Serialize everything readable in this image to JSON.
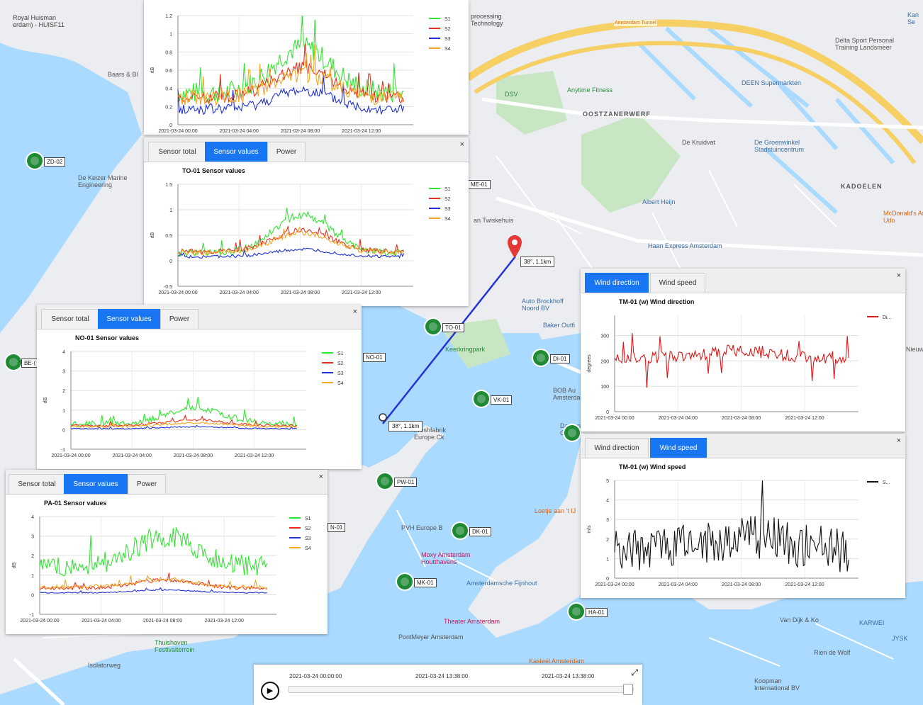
{
  "colors": {
    "s1": "#2ee82e",
    "s2": "#e8301e",
    "s3": "#2030d8",
    "s4": "#f5a623",
    "wind_dir": "#dd1515",
    "wind_speed": "#111111",
    "tab_active": "#1976f2"
  },
  "tabs_sensor": {
    "total": "Sensor total",
    "values": "Sensor values",
    "power": "Power"
  },
  "tabs_wind": {
    "direction": "Wind direction",
    "speed": "Wind speed"
  },
  "close_glyph": "×",
  "legend_sensor": [
    "S1",
    "S2",
    "S3",
    "S4"
  ],
  "chart_data": [
    {
      "id": "chart-top",
      "type": "line",
      "title": "",
      "ylabel": "dB",
      "ylim": [
        0,
        1.2
      ],
      "yticks": [
        "0",
        "0.2",
        "0.4",
        "0.6",
        "0.8",
        "1",
        "1.2"
      ],
      "xticks": [
        "2021-03-24 00:00",
        "2021-03-24 04:00",
        "2021-03-24 08:00",
        "2021-03-24 12:00"
      ],
      "series": [
        {
          "name": "S1",
          "base": 0.35,
          "peak": 0.85,
          "noise": 0.12
        },
        {
          "name": "S2",
          "base": 0.3,
          "peak": 0.62,
          "noise": 0.07
        },
        {
          "name": "S3",
          "base": 0.17,
          "peak": 0.38,
          "noise": 0.06
        },
        {
          "name": "S4",
          "base": 0.3,
          "peak": 0.55,
          "noise": 0.09
        }
      ]
    },
    {
      "id": "chart-to01",
      "type": "line",
      "title": "TO-01 Sensor values",
      "ylabel": "dB",
      "ylim": [
        -0.5,
        1.5
      ],
      "yticks": [
        "-0.5",
        "0",
        "0.5",
        "1",
        "1.5"
      ],
      "xticks": [
        "2021-03-24 00:00",
        "2021-03-24 04:00",
        "2021-03-24 08:00",
        "2021-03-24 12:00"
      ],
      "series": [
        {
          "name": "S1",
          "base": 0.15,
          "peak": 0.9,
          "noise": 0.07
        },
        {
          "name": "S2",
          "base": 0.18,
          "peak": 0.6,
          "noise": 0.05
        },
        {
          "name": "S3",
          "base": 0.08,
          "peak": 0.22,
          "noise": 0.03
        },
        {
          "name": "S4",
          "base": 0.16,
          "peak": 0.55,
          "noise": 0.05
        }
      ]
    },
    {
      "id": "chart-no01",
      "type": "line",
      "title": "NO-01 Sensor values",
      "ylabel": "dB",
      "ylim": [
        -1,
        4
      ],
      "yticks": [
        "-1",
        "0",
        "1",
        "2",
        "3",
        "4"
      ],
      "xticks": [
        "2021-03-24 00:00",
        "2021-03-24 04:00",
        "2021-03-24 08:00",
        "2021-03-24 12:00"
      ],
      "series": [
        {
          "name": "S1",
          "base": 0.3,
          "peak": 1.1,
          "noise": 0.15
        },
        {
          "name": "S2",
          "base": 0.2,
          "peak": 0.5,
          "noise": 0.06
        },
        {
          "name": "S3",
          "base": 0.05,
          "peak": 0.15,
          "noise": 0.03
        },
        {
          "name": "S4",
          "base": 0.15,
          "peak": 0.35,
          "noise": 0.05
        }
      ]
    },
    {
      "id": "chart-pa01",
      "type": "line",
      "title": "PA-01 Sensor values",
      "ylabel": "dB",
      "ylim": [
        -1,
        4
      ],
      "yticks": [
        "-1",
        "0",
        "1",
        "2",
        "3",
        "4"
      ],
      "xticks": [
        "2021-03-24 00:00",
        "2021-03-24 04:00",
        "2021-03-24 08:00",
        "2021-03-24 12:00"
      ],
      "series": [
        {
          "name": "S1",
          "base": 1.5,
          "peak": 3.0,
          "noise": 0.55
        },
        {
          "name": "S2",
          "base": 0.35,
          "peak": 0.75,
          "noise": 0.1
        },
        {
          "name": "S3",
          "base": 0.1,
          "peak": 0.25,
          "noise": 0.03
        },
        {
          "name": "S4",
          "base": 0.4,
          "peak": 0.8,
          "noise": 0.1
        }
      ]
    },
    {
      "id": "chart-winddir",
      "type": "line",
      "title": "TM-01 (w) Wind direction",
      "ylabel": "degrees",
      "ylim": [
        0,
        380
      ],
      "yticks": [
        "0",
        "100",
        "200",
        "300"
      ],
      "xticks": [
        "2021-03-24 00:00",
        "2021-03-24 04:00",
        "2021-03-24 08:00",
        "2021-03-24 12:00"
      ],
      "series": [
        {
          "name": "Di...",
          "base": 215,
          "peak": 240,
          "noise": 25
        }
      ]
    },
    {
      "id": "chart-windspeed",
      "type": "line",
      "title": "TM-01 (w) Wind speed",
      "ylabel": "m/s",
      "ylim": [
        0,
        5
      ],
      "yticks": [
        "0",
        "1",
        "2",
        "3",
        "4",
        "5"
      ],
      "xticks": [
        "2021-03-24 00:00",
        "2021-03-24 04:00",
        "2021-03-24 08:00",
        "2021-03-24 12:00"
      ],
      "series": [
        {
          "name": "S...",
          "base": 1.5,
          "peak": 2.2,
          "noise": 1.2
        }
      ]
    }
  ],
  "markers": [
    {
      "id": "ZD-02",
      "label": "ZD-02"
    },
    {
      "id": "TO-01",
      "label": "TO-01"
    },
    {
      "id": "NO-01",
      "label": "NO-01"
    },
    {
      "id": "BE",
      "label": "BE-("
    },
    {
      "id": "DI-01",
      "label": "DI-01"
    },
    {
      "id": "VK-01",
      "label": "VK-01"
    },
    {
      "id": "PW-01",
      "label": "PW-01"
    },
    {
      "id": "DK-01",
      "label": "DK-01"
    },
    {
      "id": "MK-01",
      "label": "MK-01"
    },
    {
      "id": "HA-01",
      "label": "HA-01"
    },
    {
      "id": "ME-01",
      "label": "ME-01"
    },
    {
      "id": "SN-01",
      "label": "N-01"
    }
  ],
  "distance_labels": {
    "a": "38°, 1.1km",
    "b": "38°, 1.1km"
  },
  "map_labels": {
    "royal": "Royal Huisman\nerdam) - HUISF11",
    "processing": "processing\nTechnology",
    "amsterdam_tunnel": "Amsterdam Tunnel",
    "kan": "Kan\nSe",
    "delta": "Delta Sport Personal\nTraining Landsmeer",
    "dsv": "DSV",
    "anytime": "Anytime Fitness",
    "oostzaan": "OOSTZANERWERF",
    "deen": "DEEN Supermarkten",
    "kadoelen": "KADOELEN",
    "mcdonalds": "McDonald's Am\nUdo",
    "albert": "Albert Heijn",
    "haan": "Haan Express Amsterdam",
    "de_kruidvat": "De Kruidvat",
    "groenwinkel": "De Groenwinkel\nStadstuincentrum",
    "keizer": "De Keizer Marine\nEngineering",
    "twiskehuis": "an Twiskehuis",
    "auto_brockhoff": "Auto Brockhoff\nNoord BV",
    "baker": "Baker Outfi",
    "keerkring": "Keerkringpark",
    "bob": "BOB Au\nAmsterdam",
    "damen": "Damen\nComm",
    "fresh": "Freshfabrik\nEurope Ck",
    "pvh": "PVH Europe B",
    "moxy": "Moxy Amsterdam\nHoutthavens",
    "amsterdamsche": "Amsterdamsche Fijnhout",
    "loetje": "Loetje aan 't IJ",
    "theater": "Theater Amsterdam",
    "pontmeyer": "PontMeyer Amsterdam",
    "kasteel": "Kasteel Amsterdam",
    "thuishaven": "Thuishaven\nFestivalterrein",
    "isolatorweg": "Isolatorweg",
    "vandijk": "Van Dijk & Ko",
    "karwei": "KARWEI",
    "rienwolf": "Rien de Wolf",
    "koopman": "Koopman\nInternational BV",
    "nieuwe": "Nieuwe",
    "jvk": "JYSK",
    "baars": "Baars & Bl"
  },
  "timeline": {
    "start": "2021-03-24   00:00:00",
    "current": "2021-03-24   13:38:00",
    "end": "2021-03-24   13:38:00",
    "play": "▶",
    "expand": "⤢"
  }
}
